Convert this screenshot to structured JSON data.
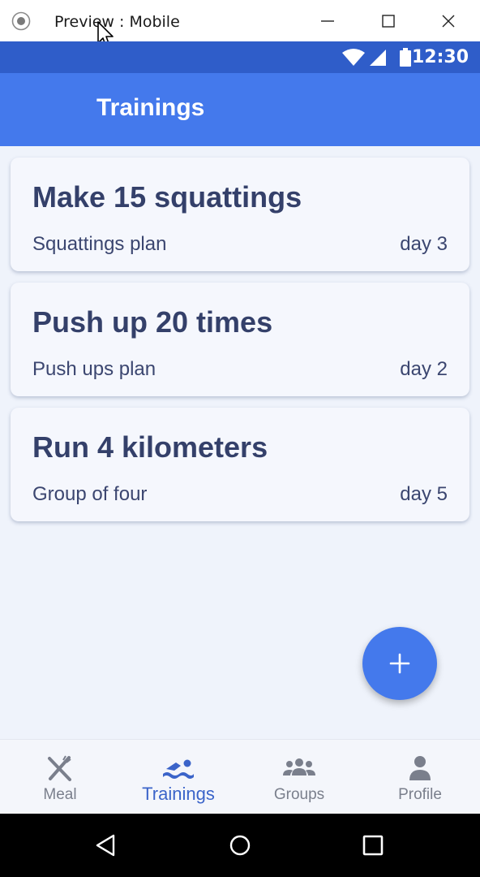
{
  "window": {
    "title": "Preview : Mobile"
  },
  "status_bar": {
    "time": "12:30"
  },
  "app_bar": {
    "title": "Trainings",
    "history_icon": "history-icon"
  },
  "trainings": [
    {
      "task": "Make 15 squattings",
      "plan": "Squattings plan",
      "day": "day 3"
    },
    {
      "task": "Push up 20 times",
      "plan": "Push ups plan",
      "day": "day 2"
    },
    {
      "task": "Run 4 kilometers",
      "plan": "Group of four",
      "day": "day 5"
    }
  ],
  "fab": {
    "icon": "plus-icon"
  },
  "bottom_nav": {
    "items": [
      {
        "label": "Meal",
        "icon": "fork-knife-icon",
        "active": false
      },
      {
        "label": "Trainings",
        "icon": "swimmer-icon",
        "active": true
      },
      {
        "label": "Groups",
        "icon": "group-icon",
        "active": false
      },
      {
        "label": "Profile",
        "icon": "person-icon",
        "active": false
      }
    ]
  },
  "colors": {
    "status_bar": "#2f5dc9",
    "app_bar": "#4479ec",
    "background": "#eff3fb",
    "card_text": "#34406a",
    "active_nav": "#3b64c9",
    "inactive_nav": "#7a7f8c"
  }
}
